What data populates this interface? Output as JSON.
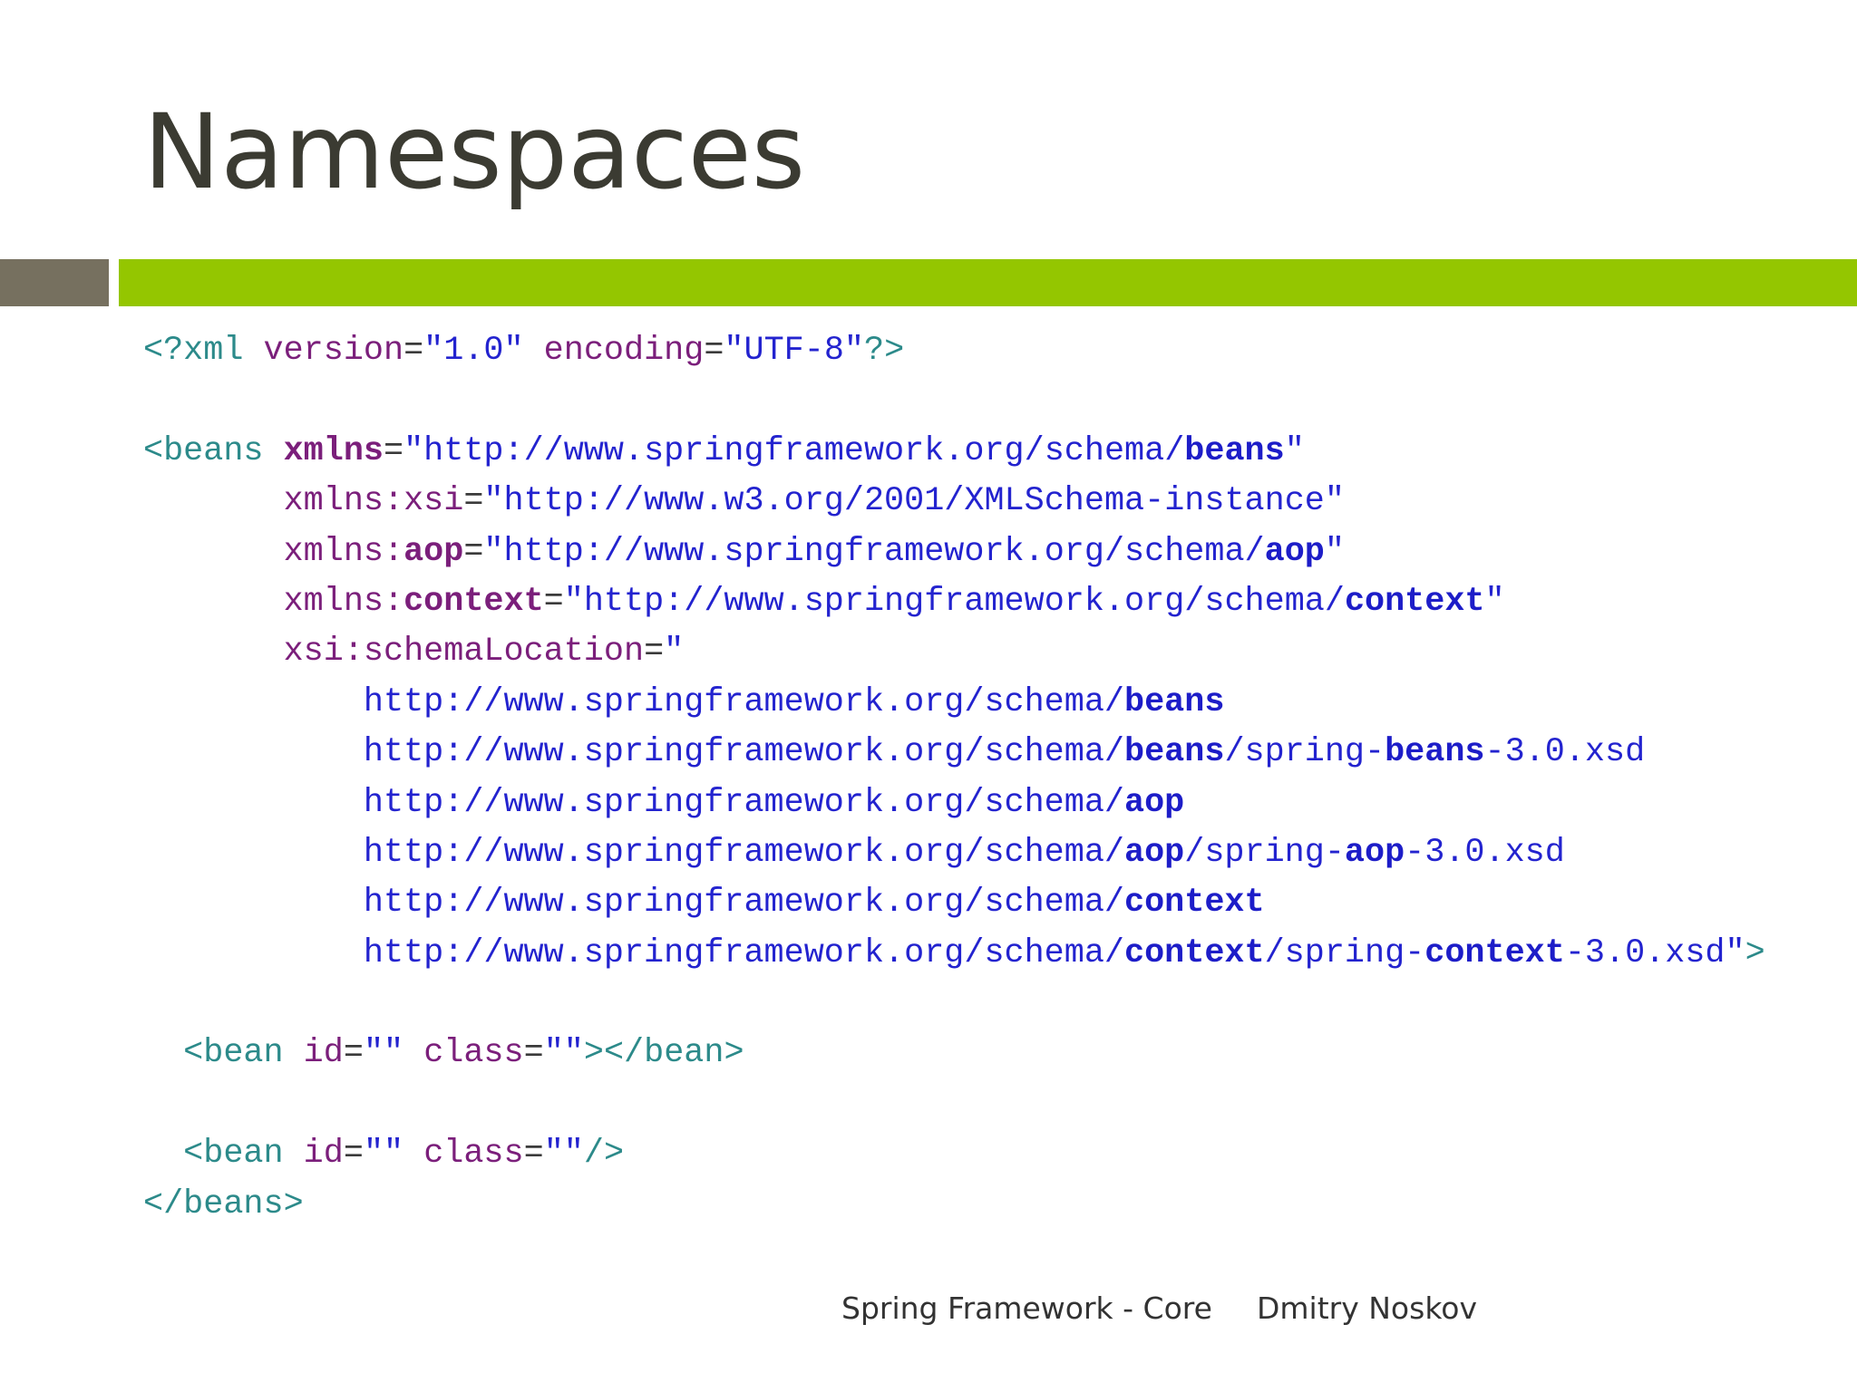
{
  "slide": {
    "title": "Namespaces",
    "footer": {
      "course": "Spring Framework - Core",
      "author": "Dmitry Noskov"
    },
    "colors": {
      "title": "#3b3b32",
      "accent_bar": "#94c600",
      "side_bar": "#76705f",
      "code_tag": "#2c8a8a",
      "code_attr": "#7b1f7b",
      "code_string": "#2323cf"
    },
    "code_lines": [
      [
        [
          "tag",
          "<?xml "
        ],
        [
          "attr",
          "version"
        ],
        [
          "plain",
          "="
        ],
        [
          "str",
          "\"1.0\" "
        ],
        [
          "attr",
          "encoding"
        ],
        [
          "plain",
          "="
        ],
        [
          "str",
          "\"UTF-8\""
        ],
        [
          "tag",
          "?>"
        ]
      ],
      [],
      [
        [
          "tag",
          "<beans "
        ],
        [
          "attrb",
          "xmlns"
        ],
        [
          "plain",
          "="
        ],
        [
          "str",
          "\"http://www.springframework.org/schema/"
        ],
        [
          "strb",
          "beans"
        ],
        [
          "str",
          "\""
        ]
      ],
      [
        [
          "plain",
          "       "
        ],
        [
          "attr",
          "xmlns:xsi"
        ],
        [
          "plain",
          "="
        ],
        [
          "str",
          "\"http://www.w3.org/2001/XMLSchema-instance\""
        ]
      ],
      [
        [
          "plain",
          "       "
        ],
        [
          "attr",
          "xmlns:"
        ],
        [
          "attrb",
          "aop"
        ],
        [
          "plain",
          "="
        ],
        [
          "str",
          "\"http://www.springframework.org/schema/"
        ],
        [
          "strb",
          "aop"
        ],
        [
          "str",
          "\""
        ]
      ],
      [
        [
          "plain",
          "       "
        ],
        [
          "attr",
          "xmlns:"
        ],
        [
          "attrb",
          "context"
        ],
        [
          "plain",
          "="
        ],
        [
          "str",
          "\"http://www.springframework.org/schema/"
        ],
        [
          "strb",
          "context"
        ],
        [
          "str",
          "\""
        ]
      ],
      [
        [
          "plain",
          "       "
        ],
        [
          "attr",
          "xsi:schemaLocation"
        ],
        [
          "plain",
          "="
        ],
        [
          "str",
          "\""
        ]
      ],
      [
        [
          "plain",
          "           "
        ],
        [
          "str",
          "http://www.springframework.org/schema/"
        ],
        [
          "strb",
          "beans"
        ]
      ],
      [
        [
          "plain",
          "           "
        ],
        [
          "str",
          "http://www.springframework.org/schema/"
        ],
        [
          "strb",
          "beans"
        ],
        [
          "str",
          "/spring-"
        ],
        [
          "strb",
          "beans"
        ],
        [
          "str",
          "-3.0.xsd"
        ]
      ],
      [
        [
          "plain",
          "           "
        ],
        [
          "str",
          "http://www.springframework.org/schema/"
        ],
        [
          "strb",
          "aop"
        ]
      ],
      [
        [
          "plain",
          "           "
        ],
        [
          "str",
          "http://www.springframework.org/schema/"
        ],
        [
          "strb",
          "aop"
        ],
        [
          "str",
          "/spring-"
        ],
        [
          "strb",
          "aop"
        ],
        [
          "str",
          "-3.0.xsd"
        ]
      ],
      [
        [
          "plain",
          "           "
        ],
        [
          "str",
          "http://www.springframework.org/schema/"
        ],
        [
          "strb",
          "context"
        ]
      ],
      [
        [
          "plain",
          "           "
        ],
        [
          "str",
          "http://www.springframework.org/schema/"
        ],
        [
          "strb",
          "context"
        ],
        [
          "str",
          "/spring-"
        ],
        [
          "strb",
          "context"
        ],
        [
          "str",
          "-3.0.xsd\""
        ],
        [
          "tag",
          ">"
        ]
      ],
      [],
      [
        [
          "plain",
          "  "
        ],
        [
          "tag",
          "<bean "
        ],
        [
          "attr",
          "id"
        ],
        [
          "plain",
          "="
        ],
        [
          "str",
          "\"\" "
        ],
        [
          "attr",
          "class"
        ],
        [
          "plain",
          "="
        ],
        [
          "str",
          "\"\""
        ],
        [
          "tag",
          "></bean>"
        ]
      ],
      [],
      [
        [
          "plain",
          "  "
        ],
        [
          "tag",
          "<bean "
        ],
        [
          "attr",
          "id"
        ],
        [
          "plain",
          "="
        ],
        [
          "str",
          "\"\" "
        ],
        [
          "attr",
          "class"
        ],
        [
          "plain",
          "="
        ],
        [
          "str",
          "\"\""
        ],
        [
          "tag",
          "/>"
        ]
      ],
      [
        [
          "tag",
          "</beans>"
        ]
      ]
    ]
  }
}
